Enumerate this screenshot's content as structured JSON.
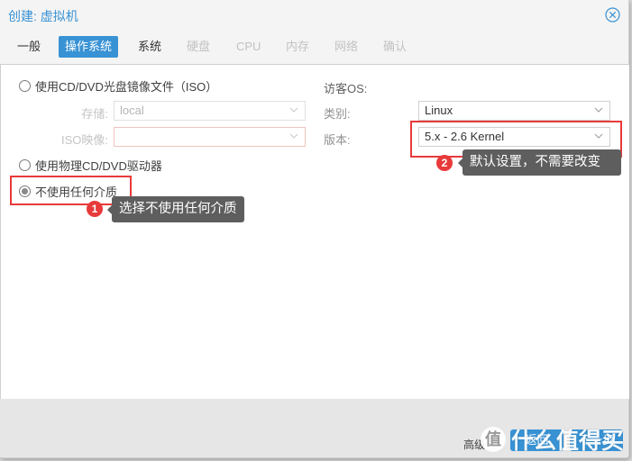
{
  "window": {
    "title": "创建: 虚拟机"
  },
  "tabs": [
    {
      "label": "一般",
      "state": "normal"
    },
    {
      "label": "操作系统",
      "state": "active"
    },
    {
      "label": "系统",
      "state": "normal"
    },
    {
      "label": "硬盘",
      "state": "disabled"
    },
    {
      "label": "CPU",
      "state": "disabled"
    },
    {
      "label": "内存",
      "state": "disabled"
    },
    {
      "label": "网络",
      "state": "disabled"
    },
    {
      "label": "确认",
      "state": "disabled"
    }
  ],
  "media": {
    "iso_option": "使用CD/DVD光盘镜像文件（ISO）",
    "storage_label": "存储:",
    "storage_value": "local",
    "iso_image_label": "ISO映像:",
    "iso_image_value": "",
    "physical_option": "使用物理CD/DVD驱动器",
    "none_option": "不使用任何介质",
    "selected": "none_option"
  },
  "guest_os": {
    "heading": "访客OS:",
    "type_label": "类别:",
    "type_value": "Linux",
    "version_label": "版本:",
    "version_value": "5.x - 2.6 Kernel"
  },
  "annotations": [
    {
      "number": "1",
      "text": "选择不使用任何介质"
    },
    {
      "number": "2",
      "text": "默认设置，不需要改变"
    }
  ],
  "footer": {
    "advanced_label": "高级",
    "back_label": "返回",
    "next_label": "下一步"
  },
  "watermark": {
    "logo": "值",
    "text": "什么值得买"
  },
  "colors": {
    "accent": "#3892d4",
    "annotation": "#e83a3a",
    "tooltip_bg": "#5e5e5e"
  }
}
